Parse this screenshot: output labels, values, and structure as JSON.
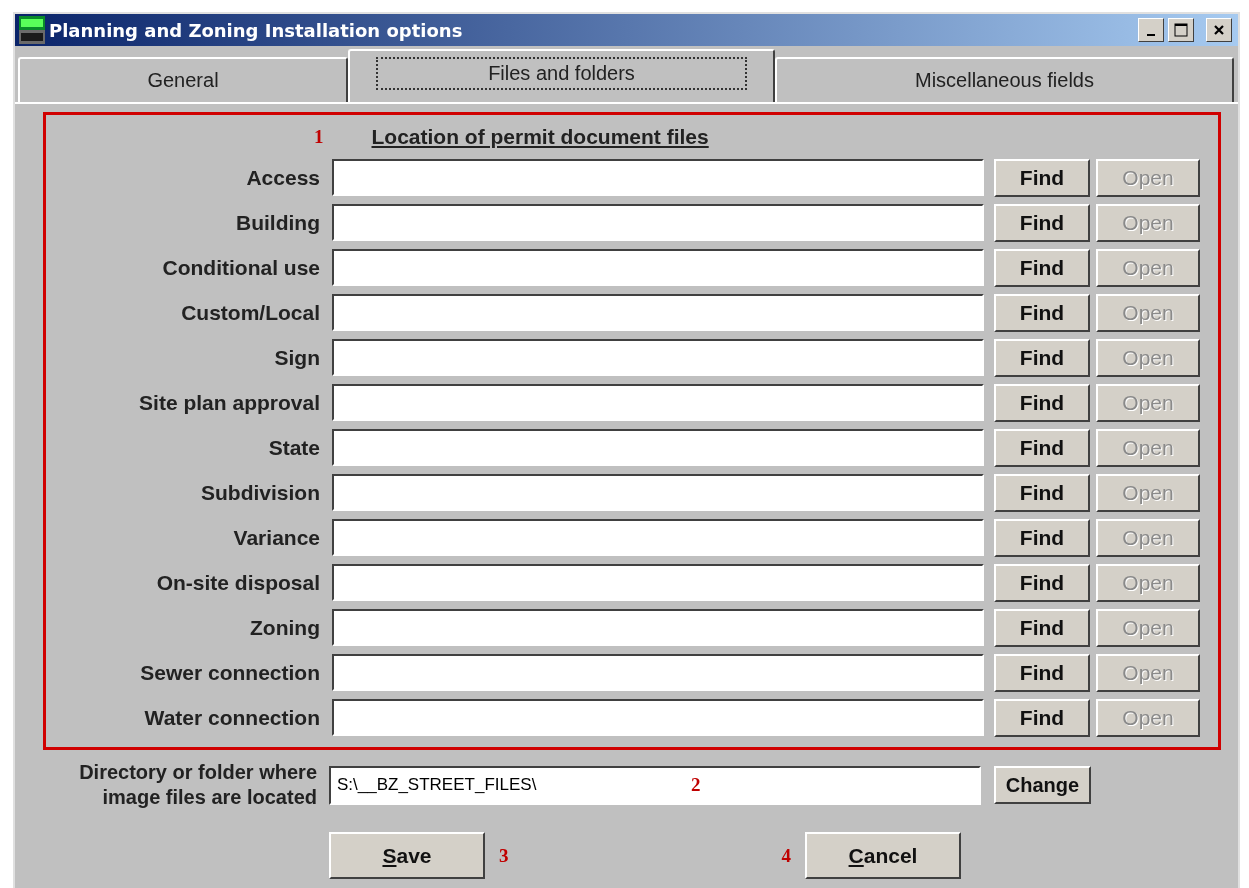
{
  "window": {
    "title": "Planning and Zoning Installation options"
  },
  "tabs": [
    {
      "label": "General",
      "selected": false
    },
    {
      "label": "Files and folders",
      "selected": true
    },
    {
      "label": "Miscellaneous fields",
      "selected": false
    }
  ],
  "section": {
    "marker": "1",
    "title": "Location of permit document files",
    "rows": [
      {
        "label": "Access",
        "value": "",
        "find": {
          "label": "Find",
          "disabled": false
        },
        "open": {
          "label": "Open",
          "disabled": true
        }
      },
      {
        "label": "Building",
        "value": "",
        "find": {
          "label": "Find",
          "disabled": false
        },
        "open": {
          "label": "Open",
          "disabled": true
        }
      },
      {
        "label": "Conditional use",
        "value": "",
        "find": {
          "label": "Find",
          "disabled": false
        },
        "open": {
          "label": "Open",
          "disabled": true
        }
      },
      {
        "label": "Custom/Local",
        "value": "",
        "find": {
          "label": "Find",
          "disabled": false
        },
        "open": {
          "label": "Open",
          "disabled": true
        }
      },
      {
        "label": "Sign",
        "value": "",
        "find": {
          "label": "Find",
          "disabled": false
        },
        "open": {
          "label": "Open",
          "disabled": true
        }
      },
      {
        "label": "Site plan approval",
        "value": "",
        "find": {
          "label": "Find",
          "disabled": false
        },
        "open": {
          "label": "Open",
          "disabled": true
        }
      },
      {
        "label": "State",
        "value": "",
        "find": {
          "label": "Find",
          "disabled": false
        },
        "open": {
          "label": "Open",
          "disabled": true
        }
      },
      {
        "label": "Subdivision",
        "value": "",
        "find": {
          "label": "Find",
          "disabled": false
        },
        "open": {
          "label": "Open",
          "disabled": true
        }
      },
      {
        "label": "Variance",
        "value": "",
        "find": {
          "label": "Find",
          "disabled": false
        },
        "open": {
          "label": "Open",
          "disabled": true
        }
      },
      {
        "label": "On-site disposal",
        "value": "",
        "find": {
          "label": "Find",
          "disabled": false
        },
        "open": {
          "label": "Open",
          "disabled": true
        }
      },
      {
        "label": "Zoning",
        "value": "",
        "find": {
          "label": "Find",
          "disabled": false
        },
        "open": {
          "label": "Open",
          "disabled": true
        }
      },
      {
        "label": "Sewer connection",
        "value": "",
        "find": {
          "label": "Find",
          "disabled": false
        },
        "open": {
          "label": "Open",
          "disabled": true
        }
      },
      {
        "label": "Water connection",
        "value": "",
        "find": {
          "label": "Find",
          "disabled": false
        },
        "open": {
          "label": "Open",
          "disabled": true
        }
      }
    ]
  },
  "image_folder": {
    "label": "Directory or folder where image files are located",
    "value": "S:\\__BZ_STREET_FILES\\",
    "marker": "2",
    "button": "Change"
  },
  "actions": [
    {
      "kind": "button",
      "label": "Save"
    },
    {
      "kind": "callout",
      "label": "3"
    },
    {
      "kind": "callout",
      "label": "4"
    },
    {
      "kind": "button",
      "label": "Cancel"
    }
  ]
}
